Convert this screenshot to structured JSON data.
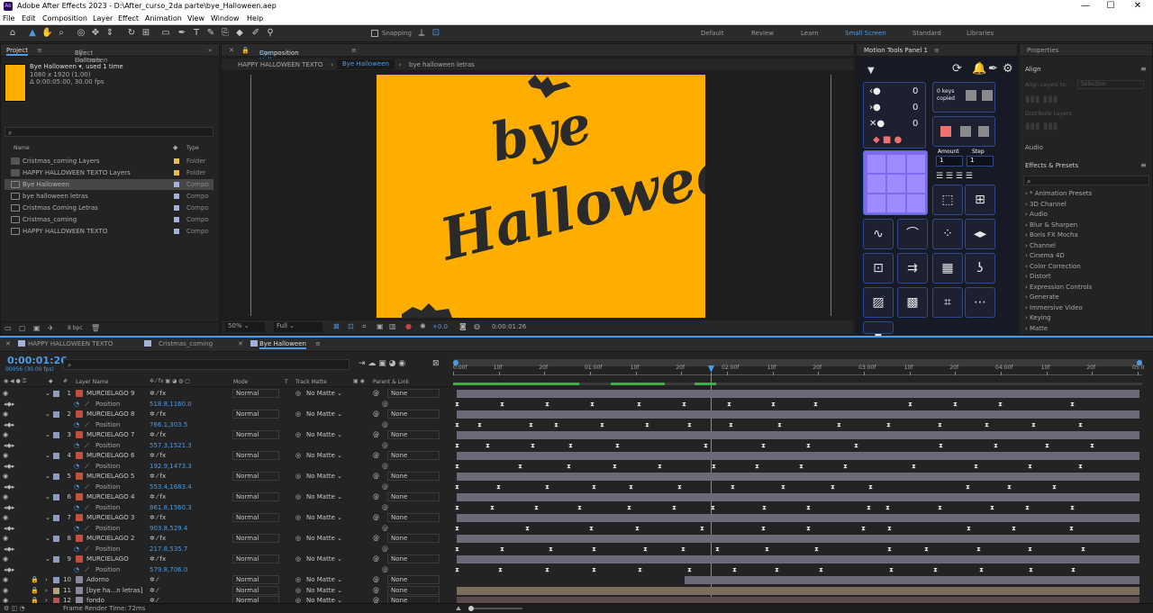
{
  "window": {
    "title": "Adobe After Effects 2023 - D:\\After_curso_2da parte\\bye_Halloween.aep",
    "logo": "Ae"
  },
  "menu": [
    "File",
    "Edit",
    "Composition",
    "Layer",
    "Effect",
    "Animation",
    "View",
    "Window",
    "Help"
  ],
  "toolbar": {
    "snapping": "Snapping",
    "workspaces": [
      "Default",
      "Review",
      "Learn",
      "Small Screen",
      "Standard",
      "Libraries"
    ],
    "active_workspace": "Small Screen"
  },
  "project": {
    "tab": "Project",
    "effect_tab": "Effect Controls",
    "effect_tab_comp": "Bye Halloween",
    "preview_name": "Bye Halloween",
    "preview_used": ", used 1 time",
    "preview_dims": "1080 x 1920 (1.00)",
    "preview_dur": "Δ 0:00:05:00, 30.00 fps",
    "col_name": "Name",
    "col_type": "Type",
    "bpc": "8 bpc",
    "items": [
      {
        "name": "Cristmas_coming Layers",
        "type": "Folder",
        "color": "#e2c04a",
        "folder": true
      },
      {
        "name": "HAPPY HALLOWEEN TEXTO Layers",
        "type": "Folder",
        "color": "#e2c04a",
        "folder": true
      },
      {
        "name": "Bye Halloween",
        "type": "Compo",
        "color": "#a3b3d6",
        "folder": false,
        "selected": true
      },
      {
        "name": "bye halloween letras",
        "type": "Compo",
        "color": "#a3b3d6",
        "folder": false
      },
      {
        "name": "Cristmas Coming Letras",
        "type": "Compo",
        "color": "#a3b3d6",
        "folder": false
      },
      {
        "name": "Cristmas_coming",
        "type": "Compo",
        "color": "#a3b3d6",
        "folder": false
      },
      {
        "name": "HAPPY HALLOWEEN TEXTO",
        "type": "Compo",
        "color": "#a3b3d6",
        "folder": false
      }
    ]
  },
  "composition": {
    "tab_label": "Composition",
    "tab_comp": "Bye Halloween",
    "crumbs": [
      "HAPPY HALLOWEEN TEXTO",
      "Bye Halloween",
      "bye halloween letras"
    ],
    "zoom": "50%",
    "quality": "Full",
    "exposure": "+0.0",
    "time": "0:00:01:26",
    "art_line1": "bye",
    "art_line2": "Halloween",
    "bg_color": "#ffae00",
    "ink_color": "#2a2a2a"
  },
  "motion_tools": {
    "title": "Motion Tools Panel 1",
    "keys_copied": "0 keys copied",
    "counts": [
      "0",
      "0",
      "0"
    ],
    "amount_label": "Amount",
    "step_label": "Step",
    "amount": "1",
    "step": "1"
  },
  "right": {
    "properties": "Properties",
    "align": "Align",
    "align_layers_to": "Align Layers to:",
    "align_to_value": "Selection",
    "distribute": "Distribute Layers:",
    "audio": "Audio",
    "effects": "Effects & Presets",
    "effects_list": [
      "* Animation Presets",
      "3D Channel",
      "Audio",
      "Blur & Sharpen",
      "Boris FX Mocha",
      "Channel",
      "Cinema 4D",
      "Color Correction",
      "Distort",
      "Expression Controls",
      "Generate",
      "Immersive Video",
      "Keying",
      "Matte"
    ]
  },
  "timeline": {
    "tabs": [
      "HAPPY HALLOWEEN TEXTO",
      "Cristmas_coming",
      "Bye Halloween"
    ],
    "active_tab": "Bye Halloween",
    "timecode": "0:00:01:26",
    "fps_info": "00056 (30.00 fps)",
    "col_layer": "Layer Name",
    "col_mode": "Mode",
    "col_t": "T",
    "col_track": "Track Matte",
    "col_parent": "Parent & Link",
    "ruler": [
      "0:00f",
      "10f",
      "20f",
      "01:00f",
      "10f",
      "20f",
      "02:00f",
      "10f",
      "20f",
      "03:00f",
      "10f",
      "20f",
      "04:00f",
      "10f",
      "20f",
      "05:0"
    ],
    "footer": "Frame Render Time:",
    "render_time": "72ms",
    "layers": [
      {
        "n": "1",
        "name": "MURCIELAGO 9",
        "pos": "518.8,1160.0",
        "label": "#8a9bc4"
      },
      {
        "n": "2",
        "name": "MURCIELAGO 8",
        "pos": "766.1,303.5",
        "label": "#8a9bc4"
      },
      {
        "n": "3",
        "name": "MURCIELAGO 7",
        "pos": "557.3,1521.3",
        "label": "#8a9bc4"
      },
      {
        "n": "4",
        "name": "MURCIELAGO 6",
        "pos": "192.9,1473.3",
        "label": "#8a9bc4"
      },
      {
        "n": "5",
        "name": "MURCIELAGO 5",
        "pos": "553.4,1683.4",
        "label": "#8a9bc4"
      },
      {
        "n": "6",
        "name": "MURCIELAGO 4",
        "pos": "861.8,1560.3",
        "label": "#8a9bc4"
      },
      {
        "n": "7",
        "name": "MURCIELAGO 3",
        "pos": "903.8,529.4",
        "label": "#8a9bc4"
      },
      {
        "n": "8",
        "name": "MURCIELAGO 2",
        "pos": "217.8,535.7",
        "label": "#8a9bc4"
      },
      {
        "n": "9",
        "name": "MURCIELAGO",
        "pos": "579.8,706.0",
        "label": "#8a9bc4"
      }
    ],
    "position_label": "Position",
    "extra_layers": [
      {
        "n": "10",
        "name": "Adorno",
        "label": "#8a9bc4"
      },
      {
        "n": "11",
        "name": "[bye ha...n letras]",
        "label": "#b5a37a"
      },
      {
        "n": "12",
        "name": "fondo",
        "label": "#c05050"
      }
    ],
    "mode": "Normal",
    "track": "No Matte",
    "parent": "None"
  }
}
